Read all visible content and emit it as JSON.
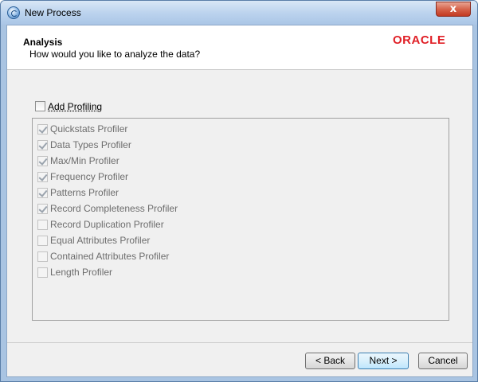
{
  "window": {
    "title": "New Process",
    "close_label": "x"
  },
  "header": {
    "title": "Analysis",
    "subtitle": "How would you like to analyze the data?",
    "logo": "ORACLE"
  },
  "add_profiling": {
    "label": "Add Profiling",
    "checked": false
  },
  "profilers": [
    {
      "label": "Quickstats Profiler",
      "checked": true
    },
    {
      "label": "Data Types Profiler",
      "checked": true
    },
    {
      "label": "Max/Min Profiler",
      "checked": true
    },
    {
      "label": "Frequency Profiler",
      "checked": true
    },
    {
      "label": "Patterns Profiler",
      "checked": true
    },
    {
      "label": "Record Completeness Profiler",
      "checked": true
    },
    {
      "label": "Record Duplication Profiler",
      "checked": false
    },
    {
      "label": "Equal Attributes Profiler",
      "checked": false
    },
    {
      "label": "Contained Attributes Profiler",
      "checked": false
    },
    {
      "label": "Length Profiler",
      "checked": false
    }
  ],
  "buttons": {
    "back": "< Back",
    "next": "Next >",
    "cancel": "Cancel"
  },
  "colors": {
    "logo": "#e01f26",
    "titlebar": "#bcd3ee",
    "close_button": "#c23a22"
  }
}
